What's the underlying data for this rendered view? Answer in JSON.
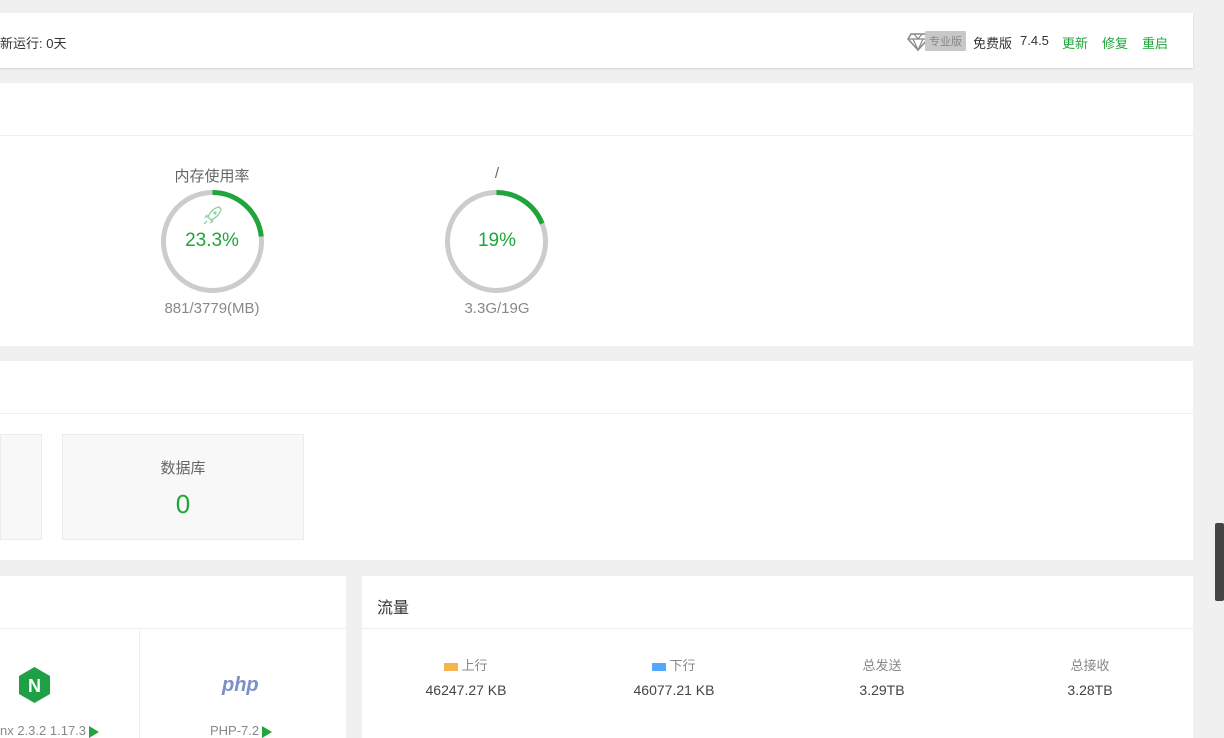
{
  "topbar": {
    "uptime": "新运行: 0天",
    "pro_label": "专业版",
    "edition": "免费版",
    "version": "7.4.5",
    "update": "更新",
    "repair": "修复",
    "restart": "重启"
  },
  "status": {
    "memory": {
      "title": "内存使用率",
      "value": "23.3%",
      "percent": 23.3,
      "detail": "881/3779(MB)"
    },
    "disk": {
      "title": "/",
      "value": "19%",
      "percent": 19,
      "detail": "3.3G/19G"
    }
  },
  "overview": {
    "database": {
      "title": "数据库",
      "count": "0"
    }
  },
  "software": {
    "nginx_label": "nx 2.3.2 1.17.3",
    "nginx_icon_letter": "N",
    "php_icon_text": "php",
    "php_label": "PHP-7.2"
  },
  "traffic": {
    "title": "流量",
    "up_label": "上行",
    "up_value": "46247.27 KB",
    "down_label": "下行",
    "down_value": "46077.21 KB",
    "total_sent_label": "总发送",
    "total_sent_value": "3.29TB",
    "total_recv_label": "总接收",
    "total_recv_value": "3.28TB",
    "colors": {
      "up": "#f5b54a",
      "down": "#52a9ff",
      "accent": "#20a53a"
    }
  }
}
